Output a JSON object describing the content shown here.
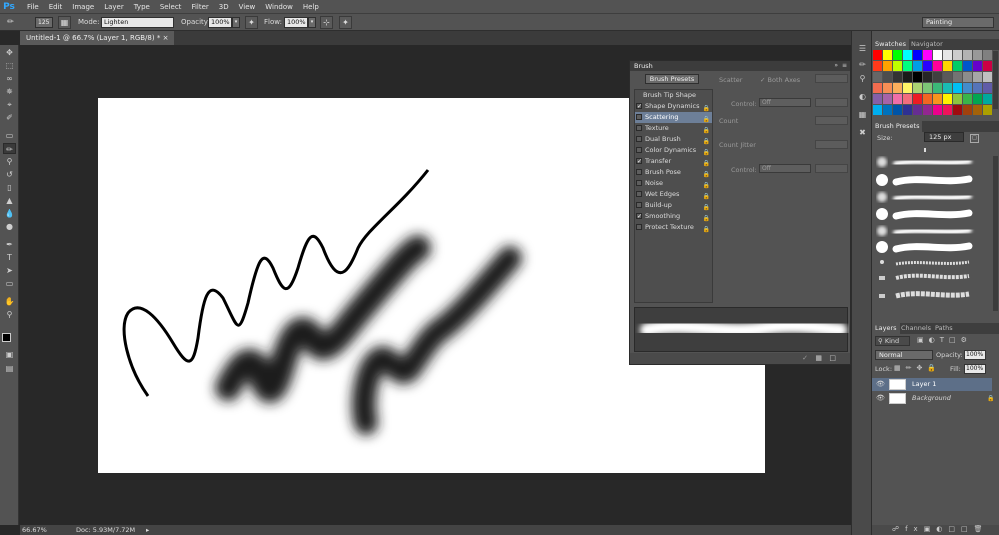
{
  "app": {
    "logo": "Ps"
  },
  "menu": [
    "File",
    "Edit",
    "Image",
    "Layer",
    "Type",
    "Select",
    "Filter",
    "3D",
    "View",
    "Window",
    "Help"
  ],
  "options": {
    "brush_size": "125",
    "mode_label": "Mode:",
    "mode_value": "Lighten",
    "opacity_label": "Opacity:",
    "opacity_value": "100%",
    "flow_label": "Flow:",
    "flow_value": "100%",
    "workspace": "Painting"
  },
  "document": {
    "tab_title": "Untitled-1 @ 66.7% (Layer 1, RGB/8) *"
  },
  "status": {
    "zoom": "66.67%",
    "doc_info": "Doc: 5.93M/7.72M"
  },
  "brush_panel": {
    "title": "Brush",
    "presets_button": "Brush Presets",
    "items": [
      {
        "label": "Brush Tip Shape",
        "checkbox": false,
        "checked": false,
        "selected": false
      },
      {
        "label": "Shape Dynamics",
        "checkbox": true,
        "checked": true,
        "selected": false
      },
      {
        "label": "Scattering",
        "checkbox": true,
        "checked": false,
        "selected": true
      },
      {
        "label": "Texture",
        "checkbox": true,
        "checked": false,
        "selected": false
      },
      {
        "label": "Dual Brush",
        "checkbox": true,
        "checked": false,
        "selected": false
      },
      {
        "label": "Color Dynamics",
        "checkbox": true,
        "checked": false,
        "selected": false
      },
      {
        "label": "Transfer",
        "checkbox": true,
        "checked": true,
        "selected": false
      },
      {
        "label": "Brush Pose",
        "checkbox": true,
        "checked": false,
        "selected": false
      },
      {
        "label": "Noise",
        "checkbox": true,
        "checked": false,
        "selected": false
      },
      {
        "label": "Wet Edges",
        "checkbox": true,
        "checked": false,
        "selected": false
      },
      {
        "label": "Build-up",
        "checkbox": true,
        "checked": false,
        "selected": false
      },
      {
        "label": "Smoothing",
        "checkbox": true,
        "checked": true,
        "selected": false
      },
      {
        "label": "Protect Texture",
        "checkbox": true,
        "checked": false,
        "selected": false
      }
    ],
    "scatter_label": "Scatter",
    "both_axes_label": "Both Axes",
    "control_label": "Control:",
    "control_value": "Off",
    "count_label": "Count",
    "count_jitter_label": "Count Jitter",
    "control2_label": "Control:",
    "control2_value": "Off"
  },
  "swatches": {
    "tab_swatches": "Swatches",
    "tab_navigator": "Navigator",
    "colors": [
      "#ff0000",
      "#ffff00",
      "#00ff00",
      "#00ffff",
      "#0000ff",
      "#ff00ff",
      "#ffffff",
      "#e6e6e6",
      "#cccccc",
      "#b3b3b3",
      "#999999",
      "#808080",
      "#ff3a1a",
      "#ffa200",
      "#bfff00",
      "#00ff7f",
      "#009ee6",
      "#2a00ff",
      "#ff0099",
      "#ffd700",
      "#00cc66",
      "#0055cc",
      "#6600cc",
      "#cc0044",
      "#666666",
      "#4d4d4d",
      "#333333",
      "#1a1a1a",
      "#000000",
      "#262626",
      "#404040",
      "#595959",
      "#737373",
      "#8c8c8c",
      "#a6a6a6",
      "#bfbfbf",
      "#f26c4f",
      "#f68e55",
      "#fbaf5c",
      "#fff467",
      "#acd372",
      "#7cc576",
      "#3bb878",
      "#1abbb4",
      "#00bff3",
      "#438ccb",
      "#5574b9",
      "#605ca8",
      "#855fa8",
      "#a763a8",
      "#f06ea9",
      "#f26d7d",
      "#ed1c24",
      "#f26522",
      "#f7941d",
      "#fff200",
      "#8dc63f",
      "#39b54a",
      "#00a651",
      "#00a99d",
      "#00aeef",
      "#0072bc",
      "#0054a6",
      "#2e3192",
      "#662d91",
      "#92278f",
      "#ec008c",
      "#ed145b",
      "#9e0b0f",
      "#a0410d",
      "#a36209",
      "#aba000"
    ]
  },
  "brush_presets": {
    "title": "Brush Presets",
    "size_label": "Size:",
    "size_value": "125 px"
  },
  "layers": {
    "tab_layers": "Layers",
    "tab_channels": "Channels",
    "tab_paths": "Paths",
    "kind_label": "Kind",
    "blend_mode": "Normal",
    "opacity_label": "Opacity:",
    "opacity_value": "100%",
    "lock_label": "Lock:",
    "fill_label": "Fill:",
    "fill_value": "100%",
    "items": [
      {
        "name": "Layer 1",
        "selected": true
      },
      {
        "name": "Background",
        "selected": false
      }
    ]
  }
}
